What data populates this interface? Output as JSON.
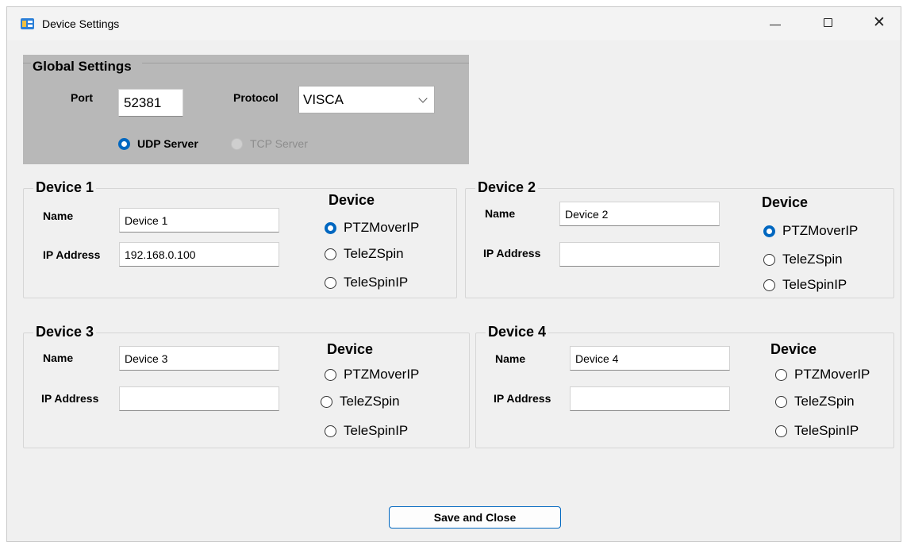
{
  "window": {
    "title": "Device Settings",
    "controls": {
      "minimize": "—",
      "maximize": "☐",
      "close": "✕"
    }
  },
  "global": {
    "legend": "Global Settings",
    "port_label": "Port",
    "port_value": "52381",
    "protocol_label": "Protocol",
    "protocol_value": "VISCA",
    "udp_label": "UDP Server",
    "tcp_label": "TCP Server",
    "udp_selected": true,
    "tcp_enabled": false
  },
  "labels": {
    "name": "Name",
    "ip": "IP Address",
    "device_heading": "Device"
  },
  "devices": [
    {
      "title": "Device 1",
      "name": "Device 1",
      "ip": "192.168.0.100",
      "types": [
        "PTZMoverIP",
        "TeleZSpin",
        "TeleSpinIP"
      ],
      "selected": "PTZMoverIP"
    },
    {
      "title": "Device 2",
      "name": "Device 2",
      "ip": "",
      "types": [
        "PTZMoverIP",
        "TeleZSpin",
        "TeleSpinIP"
      ],
      "selected": "PTZMoverIP"
    },
    {
      "title": "Device 3",
      "name": "Device 3",
      "ip": "",
      "types": [
        "PTZMoverIP",
        "TeleZSpin",
        "TeleSpinIP"
      ],
      "selected": ""
    },
    {
      "title": "Device 4",
      "name": "Device 4",
      "ip": "",
      "types": [
        "PTZMoverIP",
        "TeleZSpin",
        "TeleSpinIP"
      ],
      "selected": ""
    }
  ],
  "footer": {
    "save_label": "Save and Close"
  },
  "colors": {
    "accent": "#0067c0",
    "group_bg": "#b8b8b8",
    "window_bg": "#f0f0f0"
  }
}
